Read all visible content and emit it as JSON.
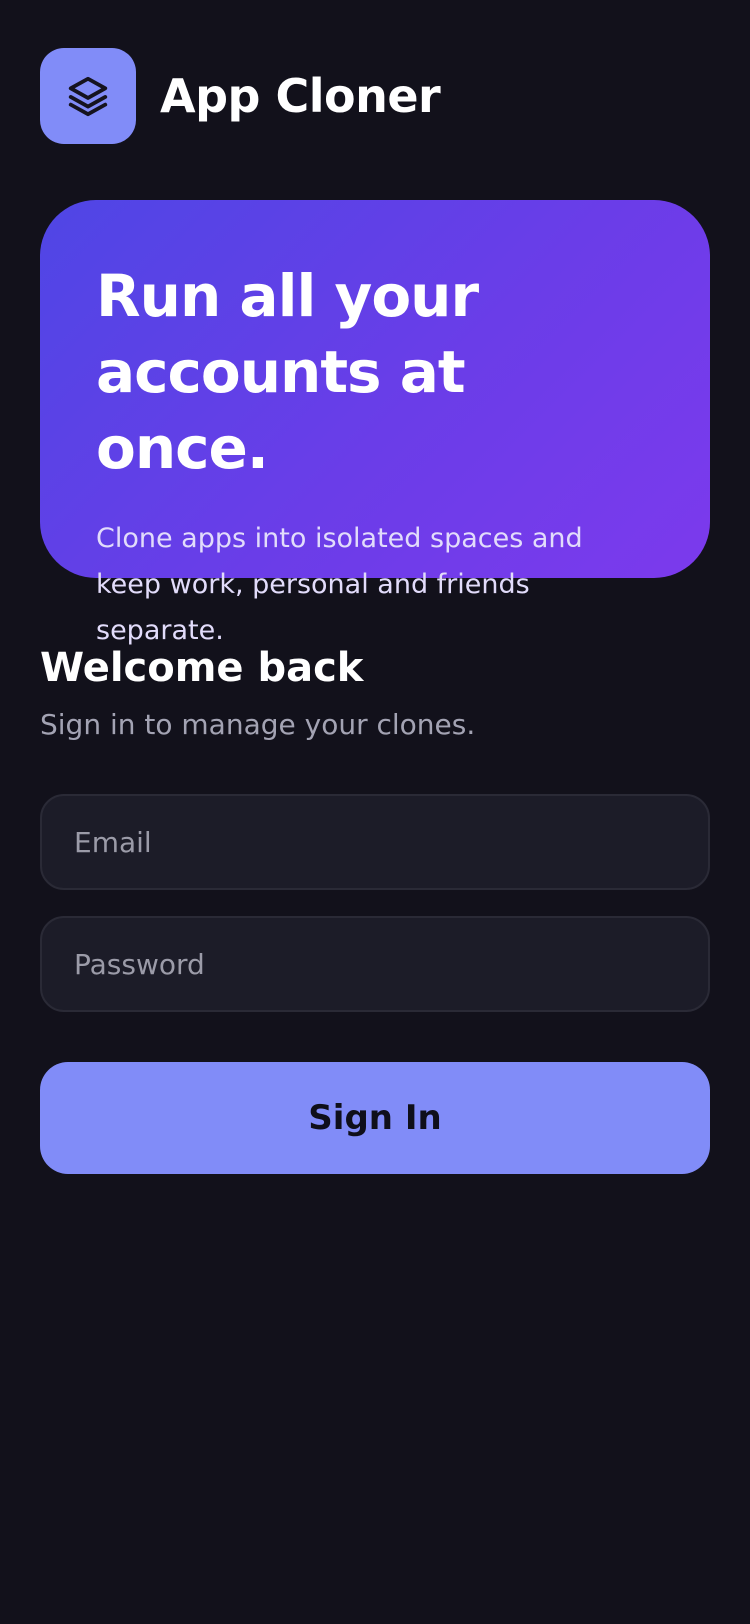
{
  "header": {
    "logo_icon": "layers-icon",
    "title": "App Cloner"
  },
  "hero": {
    "title": "Run all your accounts at once.",
    "subtitle": "Clone apps into isolated spaces and keep work, personal and friends separate."
  },
  "login": {
    "heading": "Welcome back",
    "subheading": "Sign in to manage your clones.",
    "email_placeholder": "Email",
    "email_value": "",
    "password_placeholder": "Password",
    "password_value": "",
    "submit_label": "Sign In"
  },
  "colors": {
    "background": "#12111b",
    "accent": "#818cf8",
    "hero_gradient_start": "#4f46e5",
    "hero_gradient_end": "#7c3aed",
    "field_background": "#1c1c28"
  }
}
